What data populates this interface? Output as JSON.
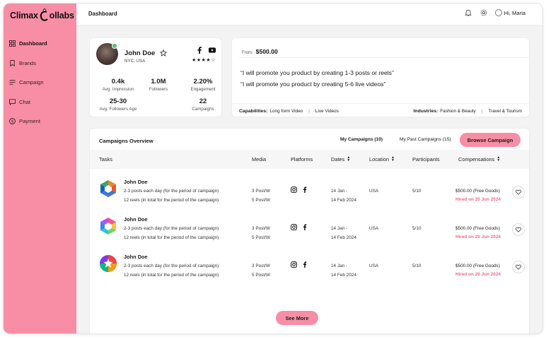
{
  "brand": {
    "logo_text_a": "Climax",
    "logo_text_b": "ollabs",
    "accent": "#f78ea5",
    "hired_color": "#f06a88"
  },
  "sidebar": {
    "items": [
      {
        "label": "Dashboard",
        "icon": "grid-icon",
        "active": true
      },
      {
        "label": "Brands",
        "icon": "bookmark-icon"
      },
      {
        "label": "Campaign",
        "icon": "list-icon"
      },
      {
        "label": "Chat",
        "icon": "chat-icon"
      },
      {
        "label": "Payment",
        "icon": "dollar-circle-icon"
      }
    ]
  },
  "topbar": {
    "title": "Dashboard",
    "greeting": "Hi, Maria"
  },
  "profile": {
    "name": "John Doe",
    "location": "NYC, USA",
    "rating": "★★★★☆",
    "stats": [
      {
        "value": "0.4k",
        "label": "Avg. Impression"
      },
      {
        "value": "1.0M",
        "label": "Followers"
      },
      {
        "value": "2.20%",
        "label": "Engagement"
      },
      {
        "value": "25-30",
        "label": "Avg. Followers Age"
      },
      {
        "value": "22",
        "label": "Campaigns"
      }
    ]
  },
  "offer": {
    "from_label": "From:",
    "price": "$500.00",
    "quotes": [
      "“I will promote you product by creating 1-3 posts or reels”",
      "“I will promote you product by creating 5-6 live videos”"
    ],
    "capabilities_label": "Capabilities:",
    "capabilities": [
      "Long form Video",
      "Live Videos"
    ],
    "industries_label": "Industries:",
    "industries": [
      "Fashion & Beauty",
      "Travel & Tourism"
    ]
  },
  "campaigns": {
    "title": "Campaigns Overview",
    "tab_mine": "My Campaigns (10)",
    "tab_past": "My Past Campaigns (15)",
    "browse_label": "Browse Campaign",
    "columns": [
      "Tasks",
      "Media",
      "Platforms",
      "Dates",
      "Location",
      "Participants",
      "Compensations"
    ],
    "rows": [
      {
        "name": "John Doe",
        "desc1": "2-3 posts each day (for the period of campaign)",
        "desc2": "12 reels (in total for the period of the campaign)",
        "media1": "3 Post/W",
        "media2": "5 Post/W",
        "date1": "14 Jan -",
        "date2": "14 Feb 2024",
        "location": "USA",
        "participants": "5/10",
        "comp": "$500.00 (Free Goods)",
        "hired": "Hired  on 20 Jun 2024",
        "logo": "hexagon-logo-icon"
      },
      {
        "name": "John Doe",
        "desc1": "2-3 posts each day (for the period of campaign)",
        "desc2": "12 reels (in total for the period of the campaign)",
        "media1": "3 Post/W",
        "media2": "5 Post/W",
        "date1": "14 Jan -",
        "date2": "14 Feb 2024",
        "location": "USA",
        "participants": "5/10",
        "comp": "$500.00 (Free Goods)",
        "hired": "Hired  on 20 Jun 2024",
        "logo": "hexagon-colorful-logo-icon"
      },
      {
        "name": "John Doe",
        "desc1": "2-3 posts each day (for the period of campaign)",
        "desc2": "12 reels (in total for the period of the campaign)",
        "media1": "3 Post/W",
        "media2": "5 Post/W",
        "date1": "14 Jan -",
        "date2": "14 Feb 2024",
        "location": "USA",
        "participants": "5/10",
        "comp": "$500.00 (Free Goods)",
        "hired": "Hired  on 20 Jun 2024",
        "logo": "star-colorful-logo-icon"
      }
    ],
    "see_more": "See More"
  }
}
